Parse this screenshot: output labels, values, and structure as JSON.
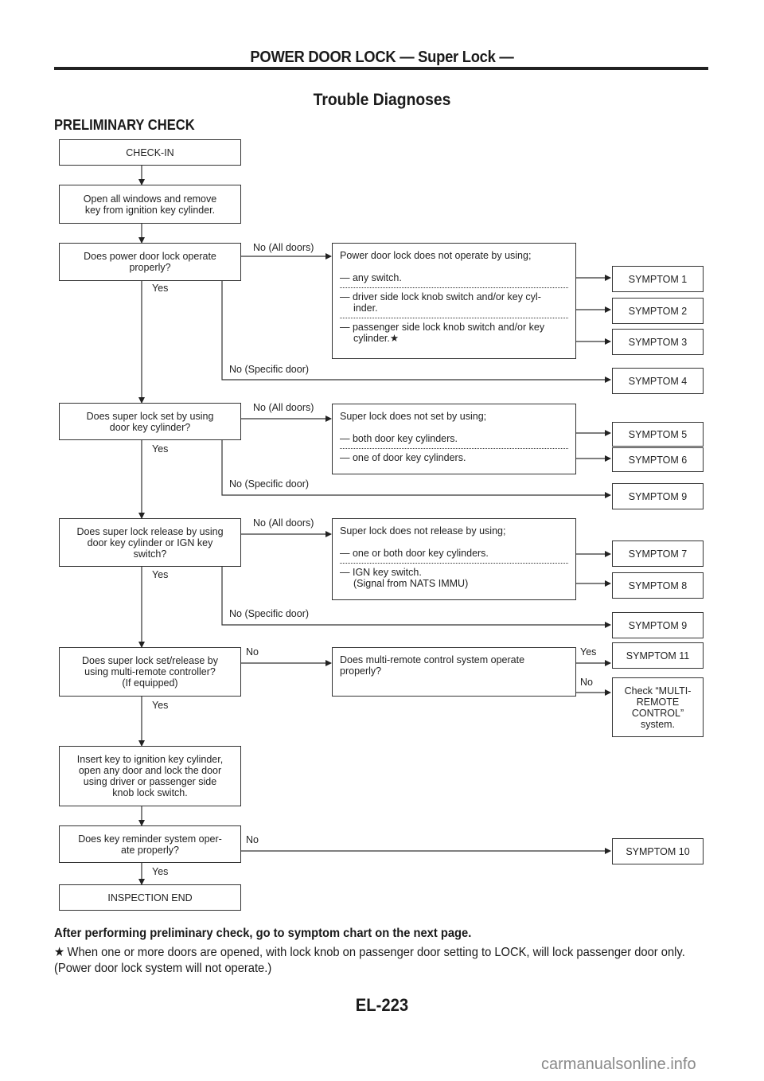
{
  "header": {
    "running_title": "POWER DOOR LOCK — Super Lock —"
  },
  "page": {
    "title": "Trouble Diagnoses",
    "section": "PRELIMINARY CHECK",
    "page_number": "EL-223"
  },
  "flow": {
    "check_in": "CHECK-IN",
    "open_windows": [
      "Open all windows and remove",
      "key from ignition key cylinder."
    ],
    "q1": [
      "Does power door lock operate",
      "properly?"
    ],
    "q2": [
      "Does super lock set by using",
      "door key cylinder?"
    ],
    "q3": [
      "Does super lock release by using",
      "door key cylinder or IGN key",
      "switch?"
    ],
    "q4": [
      "Does super lock set/release by",
      "using multi-remote controller?",
      "(If equipped)"
    ],
    "insert_key": [
      "Insert key to ignition key cylinder,",
      "open any door and lock the door",
      "using driver or passenger side",
      "knob lock switch."
    ],
    "q5": [
      "Does key reminder system oper-",
      "ate properly?"
    ],
    "end": "INSPECTION END",
    "labels": {
      "yes": "Yes",
      "no": "No",
      "no_all": "No (All doors)",
      "no_specific": "No (Specific door)"
    },
    "detail1": {
      "heading": "Power door lock does not operate by using;",
      "items": [
        [
          "— any switch."
        ],
        [
          "— driver side lock knob switch and/or key cyl-",
          "inder."
        ],
        [
          "— passenger side lock knob switch and/or key",
          "cylinder.★"
        ]
      ]
    },
    "detail2": {
      "heading": "Super lock does not set by using;",
      "items": [
        [
          "— both door key cylinders."
        ],
        [
          "— one of door key cylinders."
        ]
      ]
    },
    "detail3": {
      "heading": "Super lock does not release by using;",
      "items": [
        [
          "— one or both door key cylinders."
        ],
        [
          "— IGN key switch.",
          "(Signal from NATS IMMU)"
        ]
      ]
    },
    "detail4": {
      "text": [
        "Does multi-remote control system operate",
        "properly?"
      ]
    },
    "symptoms": {
      "s1": "SYMPTOM 1",
      "s2": "SYMPTOM 2",
      "s3": "SYMPTOM 3",
      "s4": "SYMPTOM 4",
      "s5": "SYMPTOM 5",
      "s6": "SYMPTOM 6",
      "s9a": "SYMPTOM 9",
      "s7": "SYMPTOM 7",
      "s8": "SYMPTOM 8",
      "s9b": "SYMPTOM 9",
      "s11": "SYMPTOM 11",
      "s10": "SYMPTOM 10",
      "check_multi": [
        "Check “MULTI-",
        "REMOTE",
        "CONTROL”",
        "system."
      ]
    }
  },
  "notes": {
    "bold": "After performing preliminary check, go to symptom chart on the next page.",
    "star_icon": "★",
    "star_note": "When one or more doors are opened, with lock knob on passenger door setting to LOCK, will lock passenger door only. (Power door lock system will not operate.)"
  },
  "watermark": "carmanualsonline.info"
}
